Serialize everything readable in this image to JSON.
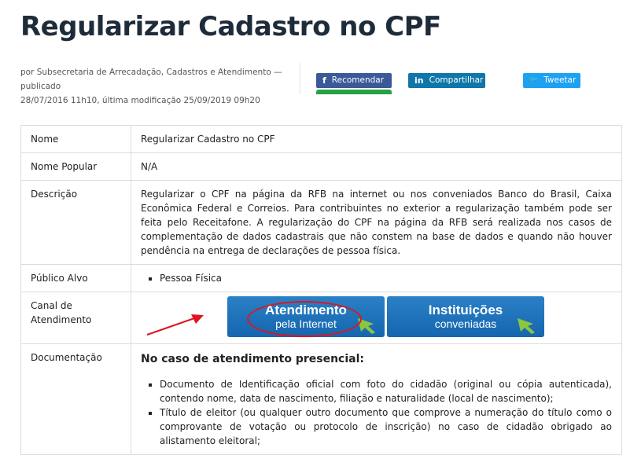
{
  "page": {
    "title": "Regularizar Cadastro no CPF",
    "byline_line1": "por Subsecretaria de Arrecadação, Cadastros e Atendimento — publicado",
    "byline_line2": "28/07/2016 11h10, última modificação 25/09/2019 09h20"
  },
  "share": {
    "facebook": {
      "label": "Recomendar",
      "icon": "f"
    },
    "linkedin": {
      "label": "Compartilhar",
      "icon": "in"
    },
    "twitter": {
      "label": "Tweetar",
      "icon": "🐦"
    }
  },
  "table": {
    "nome": {
      "label": "Nome",
      "value": "Regularizar Cadastro no CPF"
    },
    "nome_popular": {
      "label": "Nome Popular",
      "value": "N/A"
    },
    "descricao": {
      "label": "Descrição",
      "value": "Regularizar o CPF na página da RFB na internet ou nos conveniados Banco do Brasil, Caixa Econômica Federal e Correios. Para contribuintes no exterior a regularização também pode ser feita pelo Receitafone. A regularização do CPF na página da RFB será realizada nos casos de complementação de dados cadastrais que não constem na base de dados e quando não houver pendência na entrega de declarações de pessoa física."
    },
    "publico_alvo": {
      "label": "Público Alvo",
      "items": [
        "Pessoa Física"
      ]
    },
    "canal": {
      "label_line1": "Canal de",
      "label_line2": "Atendimento",
      "buttons": [
        {
          "title": "Atendimento",
          "subtitle": "pela Internet"
        },
        {
          "title": "Instituições",
          "subtitle": "conveniadas"
        }
      ]
    },
    "documentacao": {
      "label": "Documentação",
      "heading": "No caso de atendimento presencial:",
      "items": [
        "Documento de Identificação oficial com foto do cidadão (original ou cópia autenticada), contendo nome, data de nascimento, filiação e naturalidade (local de nascimento);",
        "Título de eleitor (ou qualquer outro documento que comprove a numeração do título como o comprovante de votação ou protocolo de inscrição) no caso de cidadão obrigado ao alistamento eleitoral;"
      ]
    }
  },
  "colors": {
    "title": "#1e2c3a",
    "facebook": "#3b5998",
    "linkedin": "#0e76a8",
    "twitter": "#1da1f2",
    "canal_button": "#1a6fb5",
    "annotation": "#e0141e"
  }
}
